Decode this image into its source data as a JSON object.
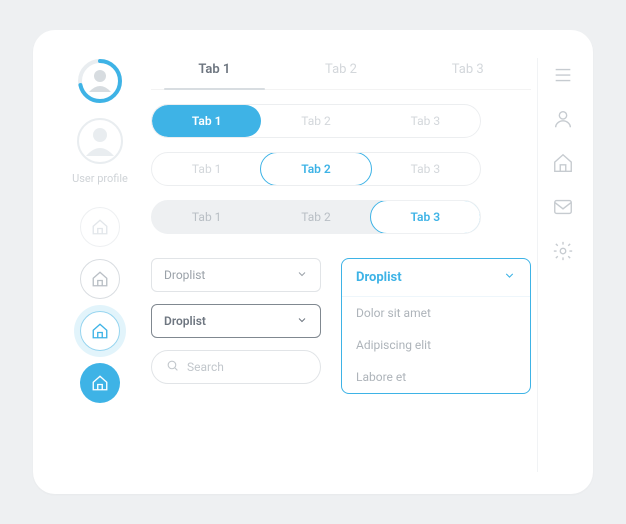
{
  "profile_label": "User profile",
  "tabbar": {
    "t1": "Tab 1",
    "t2": "Tab 2",
    "t3": "Tab 3"
  },
  "pills": {
    "row1": {
      "a": "Tab 1",
      "b": "Tab 2",
      "c": "Tab 3"
    },
    "row2": {
      "a": "Tab 1",
      "b": "Tab 2",
      "c": "Tab 3"
    },
    "row3": {
      "a": "Tab 1",
      "b": "Tab 2",
      "c": "Tab 3"
    }
  },
  "drops": {
    "light_label": "Droplist",
    "strong_label": "Droplist",
    "open_label": "Droplist",
    "options": {
      "o1": "Dolor sit amet",
      "o2": "Adipiscing elit",
      "o3": "Labore et"
    }
  },
  "search_placeholder": "Search",
  "colors": {
    "accent": "#3eb3e6"
  }
}
